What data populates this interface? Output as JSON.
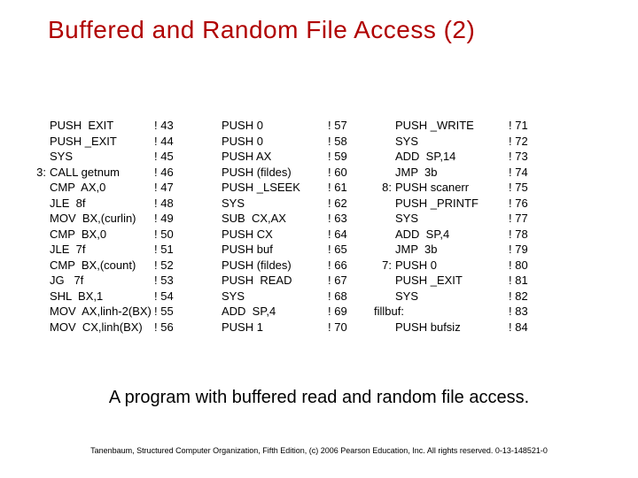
{
  "title": "Buffered and Random File Access (2)",
  "caption": "A program with buffered read and random file access.",
  "footer": "Tanenbaum, Structured Computer Organization, Fifth Edition, (c) 2006 Pearson Education, Inc. All rights reserved. 0-13-148521-0",
  "columns": [
    [
      {
        "label": "",
        "instr": "PUSH  EXIT",
        "bang": "! 43"
      },
      {
        "label": "",
        "instr": "PUSH _EXIT",
        "bang": "! 44"
      },
      {
        "label": "",
        "instr": "SYS",
        "bang": "! 45"
      },
      {
        "label": "3:",
        "instr": "CALL getnum",
        "bang": "! 46"
      },
      {
        "label": "",
        "instr": "CMP  AX,0",
        "bang": "! 47"
      },
      {
        "label": "",
        "instr": "JLE  8f",
        "bang": "! 48"
      },
      {
        "label": "",
        "instr": "MOV  BX,(curlin)",
        "bang": "! 49"
      },
      {
        "label": "",
        "instr": "CMP  BX,0",
        "bang": "! 50"
      },
      {
        "label": "",
        "instr": "JLE  7f",
        "bang": "! 51"
      },
      {
        "label": "",
        "instr": "CMP  BX,(count)",
        "bang": "! 52"
      },
      {
        "label": "",
        "instr": "JG   7f",
        "bang": "! 53"
      },
      {
        "label": "",
        "instr": "SHL  BX,1",
        "bang": "! 54"
      },
      {
        "label": "",
        "instr": "MOV  AX,linh-2(BX)",
        "bang": "! 55"
      },
      {
        "label": "",
        "instr": "MOV  CX,linh(BX)",
        "bang": "! 56"
      }
    ],
    [
      {
        "label": "",
        "instr": "PUSH 0",
        "bang": "! 57"
      },
      {
        "label": "",
        "instr": "PUSH 0",
        "bang": "! 58"
      },
      {
        "label": "",
        "instr": "PUSH AX",
        "bang": "! 59"
      },
      {
        "label": "",
        "instr": "PUSH (fildes)",
        "bang": "! 60"
      },
      {
        "label": "",
        "instr": "PUSH _LSEEK",
        "bang": "! 61"
      },
      {
        "label": "",
        "instr": "SYS",
        "bang": "! 62"
      },
      {
        "label": "",
        "instr": "SUB  CX,AX",
        "bang": "! 63"
      },
      {
        "label": "",
        "instr": "PUSH CX",
        "bang": "! 64"
      },
      {
        "label": "",
        "instr": "PUSH buf",
        "bang": "! 65"
      },
      {
        "label": "",
        "instr": "PUSH (fildes)",
        "bang": "! 66"
      },
      {
        "label": "",
        "instr": "PUSH  READ",
        "bang": "! 67"
      },
      {
        "label": "",
        "instr": "SYS",
        "bang": "! 68"
      },
      {
        "label": "",
        "instr": "ADD  SP,4",
        "bang": "! 69"
      },
      {
        "label": "",
        "instr": "PUSH 1",
        "bang": "! 70"
      }
    ],
    [
      {
        "label": "",
        "instr": "PUSH _WRITE",
        "bang": "! 71"
      },
      {
        "label": "",
        "instr": "SYS",
        "bang": "! 72"
      },
      {
        "label": "",
        "instr": "ADD  SP,14",
        "bang": "! 73"
      },
      {
        "label": "",
        "instr": "JMP  3b",
        "bang": "! 74"
      },
      {
        "label": "8:",
        "instr": "PUSH scanerr",
        "bang": "! 75"
      },
      {
        "label": "",
        "instr": "PUSH _PRINTF",
        "bang": "! 76"
      },
      {
        "label": "",
        "instr": "SYS",
        "bang": "! 77"
      },
      {
        "label": "",
        "instr": "ADD  SP,4",
        "bang": "! 78"
      },
      {
        "label": "",
        "instr": "JMP  3b",
        "bang": "! 79"
      },
      {
        "label": "7:",
        "instr": "PUSH 0",
        "bang": "! 80"
      },
      {
        "label": "",
        "instr": "PUSH _EXIT",
        "bang": "! 81"
      },
      {
        "label": "",
        "instr": "SYS",
        "bang": "! 82"
      },
      {
        "label": "fillbuf:",
        "instr": "",
        "bang": "! 83"
      },
      {
        "label": "",
        "instr": "PUSH bufsiz",
        "bang": "! 84"
      }
    ]
  ]
}
